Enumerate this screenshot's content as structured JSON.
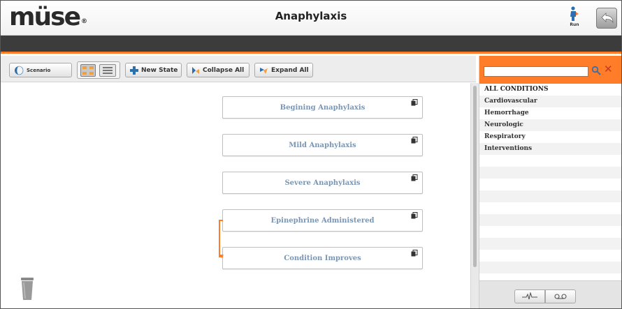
{
  "header": {
    "logo_text": "müse",
    "logo_mark": "®",
    "title": "Anaphylaxis",
    "run_label": "Run"
  },
  "toolbar": {
    "scenario_label": "Scenario",
    "new_state_label": "New State",
    "collapse_all_label": "Collapse All",
    "expand_all_label": "Expand All"
  },
  "states": [
    {
      "label": "Begining Anaphylaxis"
    },
    {
      "label": "Mild Anaphylaxis"
    },
    {
      "label": "Severe Anaphylaxis"
    },
    {
      "label": "Epinephrine Administered"
    },
    {
      "label": "Condition Improves"
    }
  ],
  "panel": {
    "search_value": "",
    "items": [
      {
        "label": "ALL CONDITIONS"
      },
      {
        "label": "Cardiovascular"
      },
      {
        "label": "Hemorrhage"
      },
      {
        "label": "Neurologic"
      },
      {
        "label": "Respiratory"
      },
      {
        "label": "Interventions"
      }
    ]
  },
  "colors": {
    "accent": "#ff7d28",
    "state_text": "#7b96b3",
    "darkbar": "#3c3c3c"
  },
  "icons": [
    "run-icon",
    "back-icon",
    "scenario-icon",
    "plus-icon",
    "collapse-icon",
    "expand-icon",
    "copy-icon",
    "trash-icon",
    "search-icon",
    "clear-icon",
    "waveform-icon",
    "voicemail-icon"
  ]
}
